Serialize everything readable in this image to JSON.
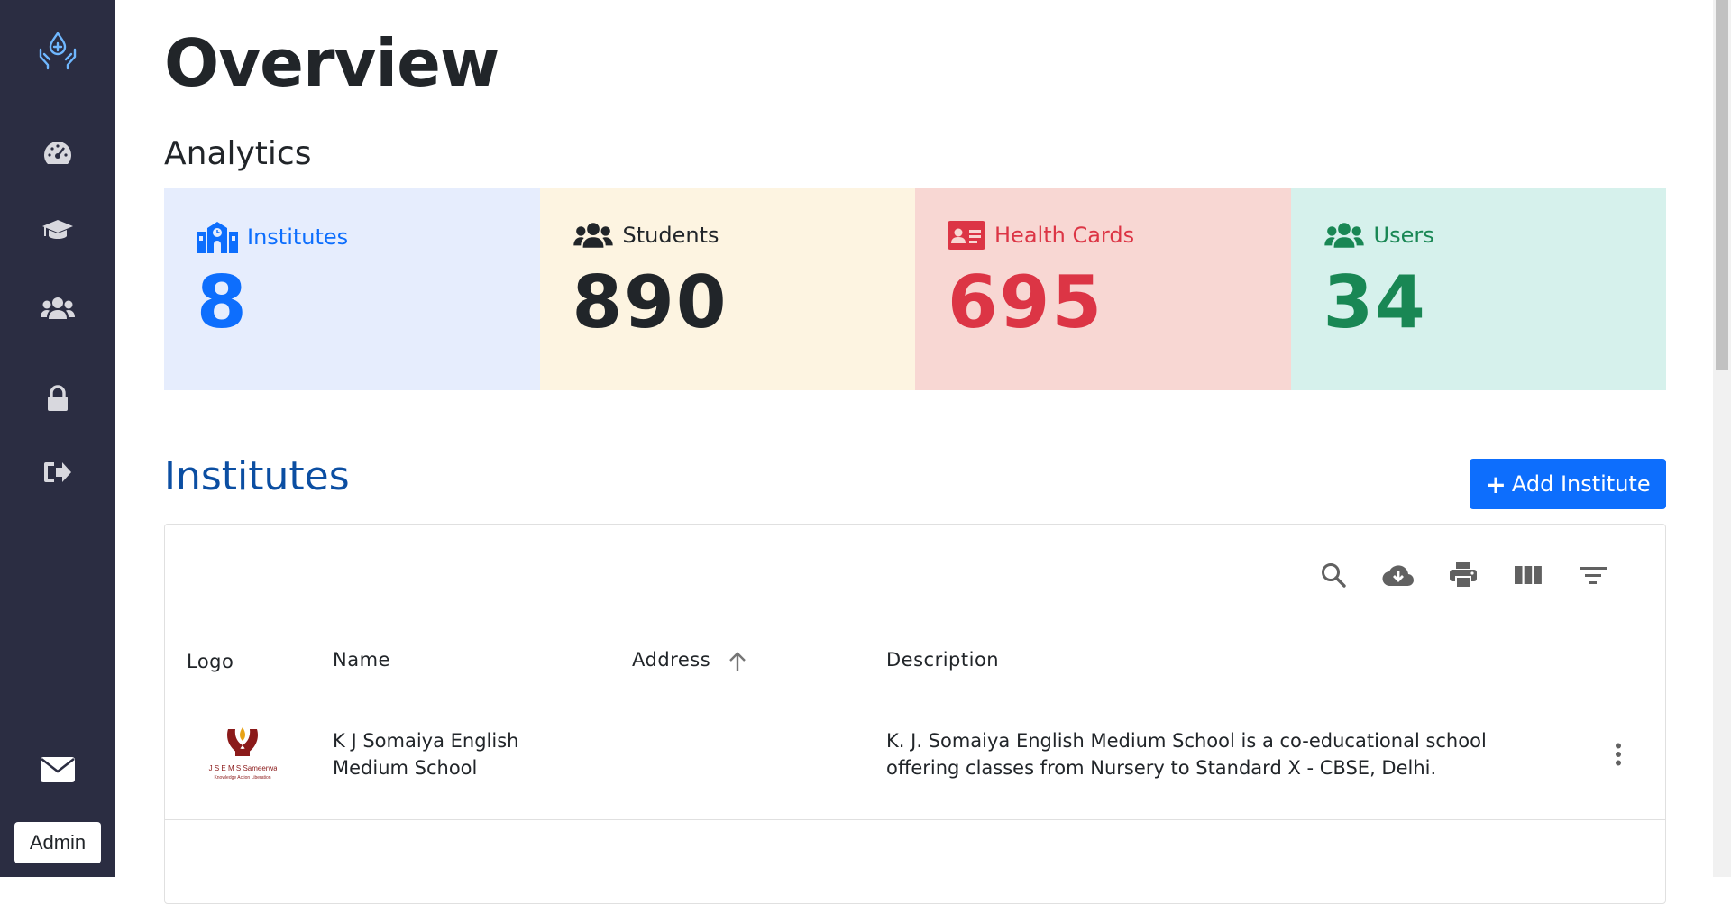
{
  "sidebar": {
    "icons": [
      "hands-droplet-icon",
      "dashboard-gauge-icon",
      "graduation-cap-icon",
      "users-icon",
      "lock-icon",
      "logout-icon",
      "envelope-icon"
    ],
    "user_badge": "Admin"
  },
  "page": {
    "title": "Overview",
    "analytics_title": "Analytics"
  },
  "stats": [
    {
      "label": "Institutes",
      "value": "8",
      "icon": "school-building-icon",
      "bg": "#e6edfd",
      "color": "#0d6efd"
    },
    {
      "label": "Students",
      "value": "890",
      "icon": "users-icon",
      "bg": "#fdf4e1",
      "color": "#212529"
    },
    {
      "label": "Health Cards",
      "value": "695",
      "icon": "id-card-icon",
      "bg": "#f8d7d3",
      "color": "#dc3545"
    },
    {
      "label": "Users",
      "value": "34",
      "icon": "users-icon",
      "bg": "#d6f1ec",
      "color": "#198754"
    }
  ],
  "institutes": {
    "title": "Institutes",
    "add_button": "Add Institute",
    "toolbar": [
      "search-icon",
      "download-cloud-icon",
      "print-icon",
      "view-columns-icon",
      "filter-icon"
    ],
    "columns": [
      "Logo",
      "Name",
      "Address",
      "Description"
    ],
    "sorted_column": "Address",
    "sort_direction": "ascending",
    "rows": [
      {
        "logo_text": "K J S E M S Sameerwadi",
        "logo_subtext": "Knowledge Action Liberation",
        "name_line1": "K J Somaiya English",
        "name_line2": "Medium School",
        "address": "",
        "description_line1": "K. J. Somaiya English Medium School is a co-educational school",
        "description_line2": "offering classes from Nursery to Standard X - CBSE, Delhi."
      }
    ]
  },
  "colors": {
    "sidebar_bg": "#2b2d42",
    "accent": "#0d6efd",
    "institutes_heading": "#0b4ea2"
  }
}
